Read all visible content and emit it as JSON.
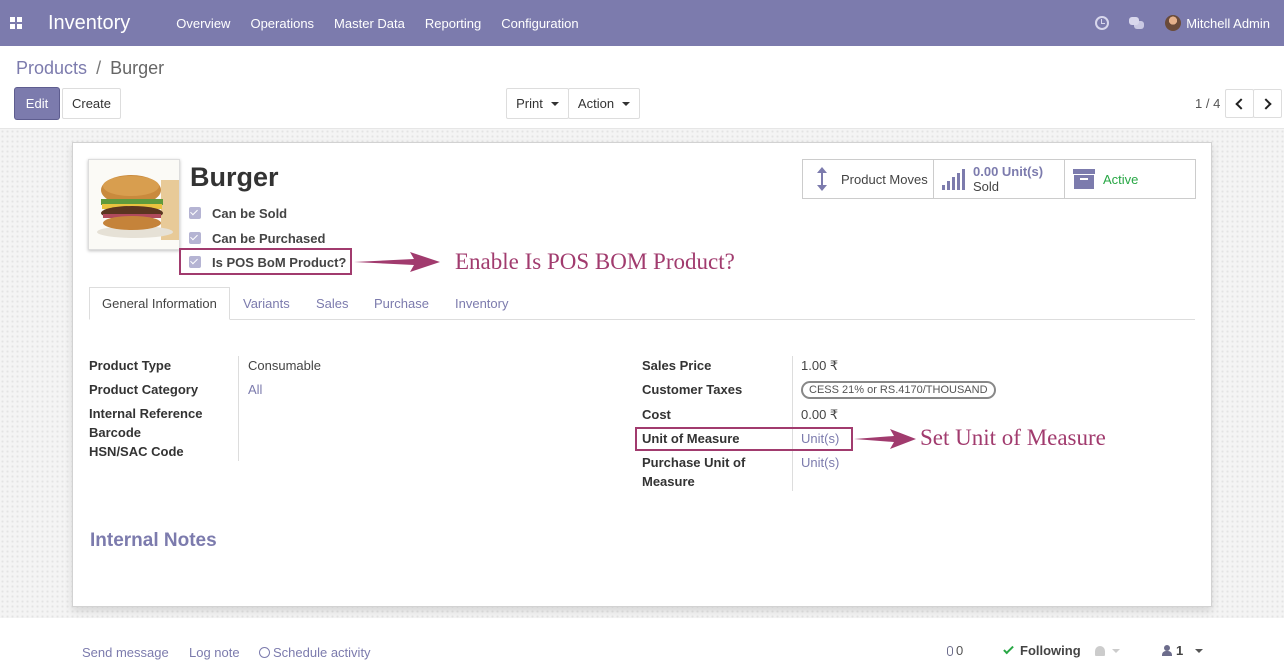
{
  "navbar": {
    "app_name": "Inventory",
    "menu": [
      "Overview",
      "Operations",
      "Master Data",
      "Reporting",
      "Configuration"
    ],
    "user_name": "Mitchell Admin",
    "icons": [
      "apps-icon",
      "clock-icon",
      "chat-icon",
      "avatar"
    ]
  },
  "breadcrumb": {
    "parent": "Products",
    "separator": "/",
    "current": "Burger"
  },
  "buttons": {
    "edit": "Edit",
    "create": "Create",
    "print": "Print",
    "action": "Action"
  },
  "pager": {
    "value": "1 / 4"
  },
  "product": {
    "name": "Burger",
    "image_alt": "burger photo",
    "checkboxes": [
      {
        "label": "Can be Sold",
        "checked": true
      },
      {
        "label": "Can be Purchased",
        "checked": true
      },
      {
        "label": "Is POS BoM Product?",
        "checked": true
      }
    ]
  },
  "smart_buttons": {
    "moves": "Product Moves",
    "sold_value": "0.00 Unit(s)",
    "sold_label": "Sold",
    "active": "Active"
  },
  "tabs": [
    "General Information",
    "Variants",
    "Sales",
    "Purchase",
    "Inventory"
  ],
  "fields_left": {
    "product_type_label": "Product Type",
    "product_type_value": "Consumable",
    "category_label": "Product Category",
    "category_value": "All",
    "internal_ref_label": "Internal Reference",
    "barcode_label": "Barcode",
    "hsn_label": "HSN/SAC Code"
  },
  "fields_right": {
    "sales_price_label": "Sales Price",
    "sales_price_value": "1.00 ₹",
    "customer_taxes_label": "Customer Taxes",
    "customer_taxes_value": "CESS 21% or RS.4170/THOUSAND",
    "cost_label": "Cost",
    "cost_value": "0.00 ₹",
    "uom_label": "Unit of Measure",
    "uom_value": "Unit(s)",
    "purchase_uom_label_1": "Purchase Unit of",
    "purchase_uom_label_2": "Measure",
    "purchase_uom_value": "Unit(s)"
  },
  "internal_notes": "Internal Notes",
  "annotations": {
    "pos_bom": "Enable Is POS BOM Product?",
    "uom": "Set Unit of Measure",
    "color": "#a13b6e"
  },
  "chatter": {
    "send_message": "Send message",
    "log_note": "Log note",
    "schedule_activity": "Schedule activity",
    "attachments": "0",
    "following": "Following",
    "followers": "1"
  },
  "colors": {
    "brand": "#7c7bad",
    "active": "#28a745"
  }
}
